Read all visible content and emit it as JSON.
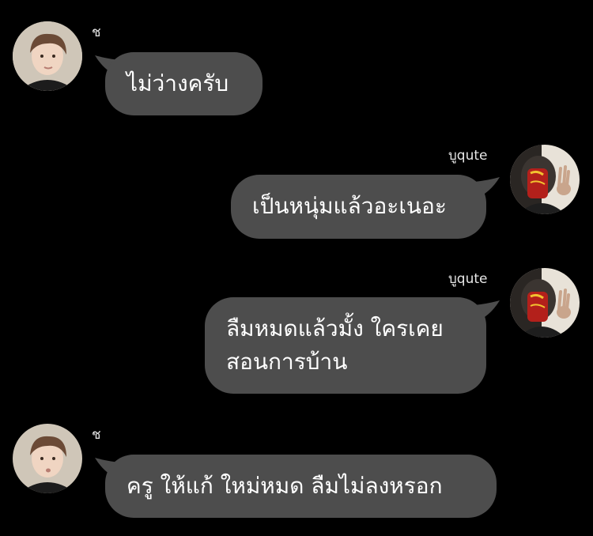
{
  "chat": {
    "messages": [
      {
        "sender": "ช",
        "side": "left",
        "lines": [
          "ไม่ว่างครับ"
        ]
      },
      {
        "sender": "บูqute",
        "side": "right",
        "lines": [
          "เป็นหนุ่มแล้วอะเนอะ"
        ]
      },
      {
        "sender": "บูqute",
        "side": "right",
        "lines": [
          "ลืมหมดแล้วมั้ง ใครเคย",
          "สอนการบ้าน"
        ]
      },
      {
        "sender": "ช",
        "side": "left",
        "lines": [
          "ครู ให้แก้ ใหม่หมด ลืมไม่ลงหรอก"
        ]
      }
    ]
  },
  "colors": {
    "background": "#000000",
    "bubble": "#4d4d4d",
    "text": "#ffffff"
  }
}
